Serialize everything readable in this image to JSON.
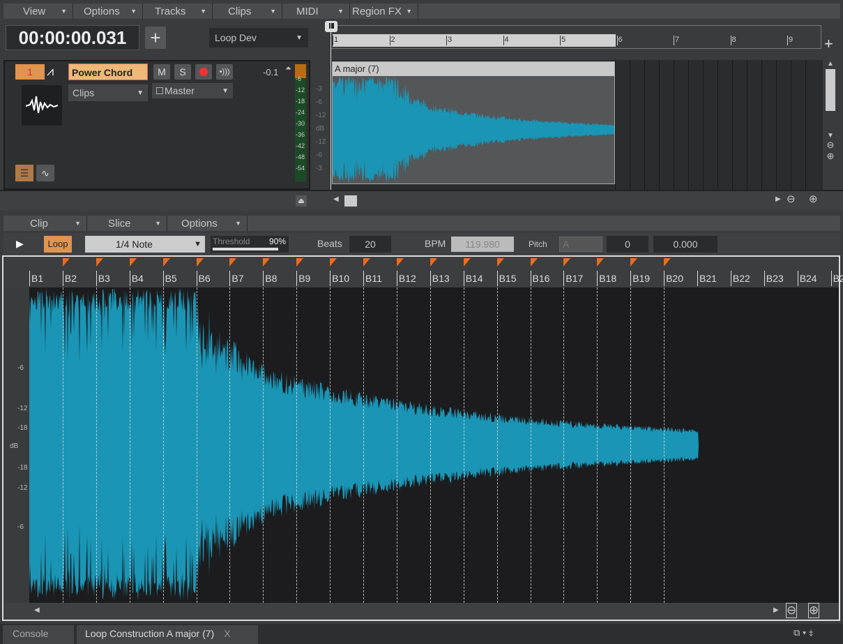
{
  "top_menu": [
    {
      "label": "View"
    },
    {
      "label": "Options"
    },
    {
      "label": "Tracks"
    },
    {
      "label": "Clips"
    },
    {
      "label": "MIDI"
    },
    {
      "label": "Region FX"
    }
  ],
  "time_display": "00:00:00.031",
  "add_label": "+",
  "workspace": "Loop Dev",
  "ruler": [
    "1",
    "2",
    "3",
    "4",
    "5",
    "6",
    "7",
    "8",
    "9"
  ],
  "track": {
    "number": "1",
    "name": "Power Chord",
    "mute": "M",
    "solo": "S",
    "input": "Clips",
    "output": "Master",
    "volume": "-0.1",
    "meter_ticks": [
      "-6",
      "-12",
      "-18",
      "-24",
      "-30",
      "-36",
      "-42",
      "-48",
      "-54"
    ]
  },
  "clip": {
    "name": "A major (7)",
    "color": "#1a95b5"
  },
  "lane_scale": [
    "-3",
    "-6",
    "-12",
    "dB",
    "-12",
    "-6",
    "-3"
  ],
  "lower_menu": [
    {
      "label": "Clip"
    },
    {
      "label": "Slice"
    },
    {
      "label": "Options"
    }
  ],
  "loop_toolbar": {
    "loop": "Loop",
    "note": "1/4 Note",
    "threshold_label": "Threshold",
    "threshold": "90%",
    "threshold_value": 0.9,
    "beats_label": "Beats",
    "beats": "20",
    "bpm_label": "BPM",
    "bpm": "119.980",
    "pitch_label": "Pitch",
    "pitch_key": "A",
    "pitch_semi": "0",
    "pitch_fine": "0.000"
  },
  "beats": [
    "B1",
    "B2",
    "B3",
    "B4",
    "B5",
    "B6",
    "B7",
    "B8",
    "B9",
    "B10",
    "B11",
    "B12",
    "B13",
    "B14",
    "B15",
    "B16",
    "B17",
    "B18",
    "B19",
    "B20",
    "B21",
    "B22",
    "B23",
    "B24",
    "B2"
  ],
  "db_scale": [
    "-6",
    "-12",
    "-18",
    "dB",
    "-18",
    "-12",
    "-6"
  ],
  "tabs": [
    {
      "label": "Console"
    },
    {
      "label": "Loop Construction A major (7)"
    }
  ],
  "close_label": "X",
  "accent": "#e8a058"
}
